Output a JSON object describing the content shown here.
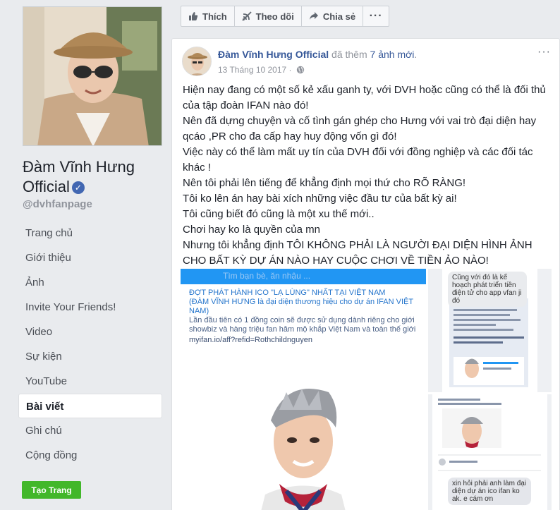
{
  "page": {
    "name": "Đàm Vĩnh Hưng Official",
    "handle": "@dvhfanpage"
  },
  "nav": {
    "items": [
      {
        "label": "Trang chủ"
      },
      {
        "label": "Giới thiệu"
      },
      {
        "label": "Ảnh"
      },
      {
        "label": "Invite Your Friends!"
      },
      {
        "label": "Video"
      },
      {
        "label": "Sự kiện"
      },
      {
        "label": "YouTube"
      },
      {
        "label": "Bài viết"
      },
      {
        "label": "Ghi chú"
      },
      {
        "label": "Cộng đồng"
      }
    ],
    "active_label": "Bài viết",
    "create_page_label": "Tạo Trang"
  },
  "action_bar": {
    "like_label": "Thích",
    "follow_label": "Theo dõi",
    "share_label": "Chia sẻ",
    "more_label": "···"
  },
  "post": {
    "author": "Đàm Vĩnh Hưng Official",
    "action_text": "đã thêm",
    "photo_count": "7 ảnh mới",
    "action_suffix": ".",
    "date": "13 Tháng 10 2017",
    "separator": "·",
    "options_label": "···",
    "lines": [
      "Hiện nay đang có một số kẻ xấu ganh ty, với DVH hoặc cũng có thể là đối thủ của tập đoàn IFAN nào đó!",
      "Nên đã dựng chuyện và cố tình gán ghép cho Hưng với vai trò đại diện hay qcáo ,PR cho đa cấp hay huy động vốn gì đó!",
      "Việc này có thể làm mất uy tín của DVH đối với đồng nghiệp và các đối tác khác !",
      "Nên tôi phải lên tiếng để khẳng định mọi thứ cho RÕ RÀNG!",
      "Tôi ko lên án hay bài xích những việc đầu tư của bất kỳ ai!",
      "Tôi cũng biết đó cũng là một xu thế mới..",
      "Chơi hay ko là quyền của mn",
      "Nhưng tôi khẳng định TÔI KHÔNG PHẢI LÀ NGƯỜI ĐẠI DIỆN HÌNH ẢNH CHO BẤT KỲ DỰ ÁN NÀO HAY CUỘC CHƠI VỀ TIỀN ẢO NÀO!"
    ]
  },
  "photo_main": {
    "search_hint": "Tìm bạn bè, ăn nhậu ...",
    "headline": "ĐỢT PHÁT HÀNH ICO \"LẠ LÙNG\" NHẤT TẠI VIỆT NAM",
    "subhead": "(ĐÀM VĨNH HƯNG là đại diện thương hiệu cho dự án IFAN VIỆT NAM)",
    "body": "Lần đầu tiên có 1 đồng coin sẽ được sử dụng dành riêng cho giới showbiz và hàng triệu fan hâm mộ khắp Việt Nam và toàn thế giới",
    "link": "myifan.io/aff?refid=Rothchildnguyen"
  },
  "photo_side1": {
    "bubble": "Cũng với đó là kế hoạch phát triển tiền điện tử cho app vfan ji đó"
  },
  "photo_side2": {
    "bubble": "xin hỏi phải anh làm đại diện dự án ico ifan ko ak. e cám ơn"
  },
  "colors": {
    "facebook_blue": "#4267b2",
    "link_blue": "#365899",
    "create_green": "#42b72a",
    "background": "#e9ebee"
  }
}
